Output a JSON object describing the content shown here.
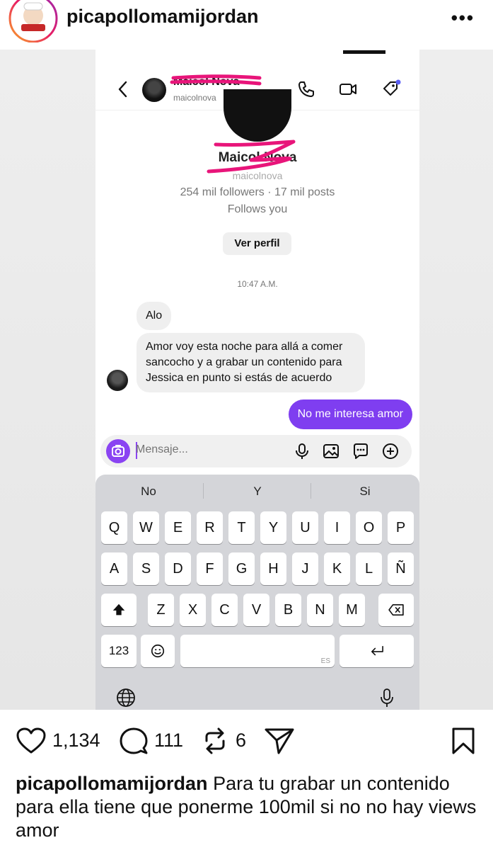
{
  "post": {
    "username": "picapollomamijordan",
    "more_label": "•••",
    "likes": "1,134",
    "comments": "111",
    "reposts": "6",
    "caption_user": "picapollomamijordan",
    "caption_text": "Para tu grabar un contenido para ella tiene que ponerme 100mil si no no hay views amor"
  },
  "chat": {
    "contact_name": "Maicol Nova",
    "contact_handle": "maicolnova",
    "profile_name": "Maicol Nova",
    "profile_handle": "maicolnova",
    "profile_stats": "254 mil followers · 17 mil posts",
    "follows_you": "Follows you",
    "view_profile_label": "Ver perfil",
    "timestamp": "10:47 A.M.",
    "messages": [
      {
        "from": "them",
        "text": "Alo"
      },
      {
        "from": "them",
        "text": "Amor voy esta noche para allá a comer sancocho y a grabar un contenido para Jessica en punto si estás de acuerdo"
      },
      {
        "from": "me",
        "text": "No me interesa amor"
      }
    ],
    "composer_placeholder": "Mensaje..."
  },
  "keyboard": {
    "suggestions": [
      "No",
      "Y",
      "Si"
    ],
    "row1": [
      "Q",
      "W",
      "E",
      "R",
      "T",
      "Y",
      "U",
      "I",
      "O",
      "P"
    ],
    "row2": [
      "A",
      "S",
      "D",
      "F",
      "G",
      "H",
      "J",
      "K",
      "L",
      "Ñ"
    ],
    "row3": [
      "Z",
      "X",
      "C",
      "V",
      "B",
      "N",
      "M"
    ],
    "numbers_key": "123",
    "space_lang": "ES"
  },
  "colors": {
    "accent_purple": "#7f3ef0",
    "scribble_pink": "#e8157a"
  }
}
